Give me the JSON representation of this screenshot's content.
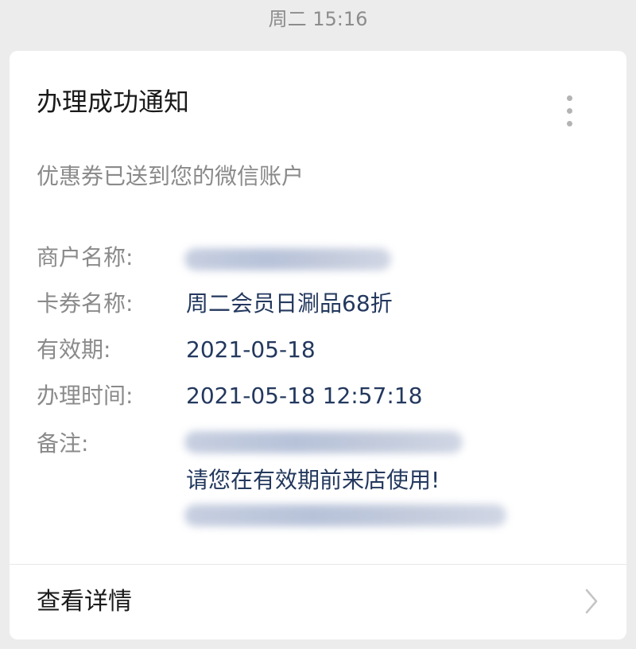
{
  "timestamp": "周二 15:16",
  "notification": {
    "title": "办理成功通知",
    "subtitle": "优惠券已送到您的微信账户",
    "fields": [
      {
        "label": "商户名称:",
        "value": ""
      },
      {
        "label": "卡券名称:",
        "value": "周二会员日涮品68折"
      },
      {
        "label": "有效期:",
        "value": "2021-05-18"
      },
      {
        "label": "办理时间:",
        "value": "2021-05-18 12:57:18"
      },
      {
        "label": "备注:",
        "value": "请您在有效期前来店使用!"
      }
    ],
    "details_label": "查看详情"
  },
  "colors": {
    "background": "#ececec",
    "card": "#ffffff",
    "value_text": "#23385e",
    "label_text": "#8a8a8a"
  },
  "icons": {
    "more": "more-vertical-icon",
    "chevron": "chevron-right-icon"
  }
}
